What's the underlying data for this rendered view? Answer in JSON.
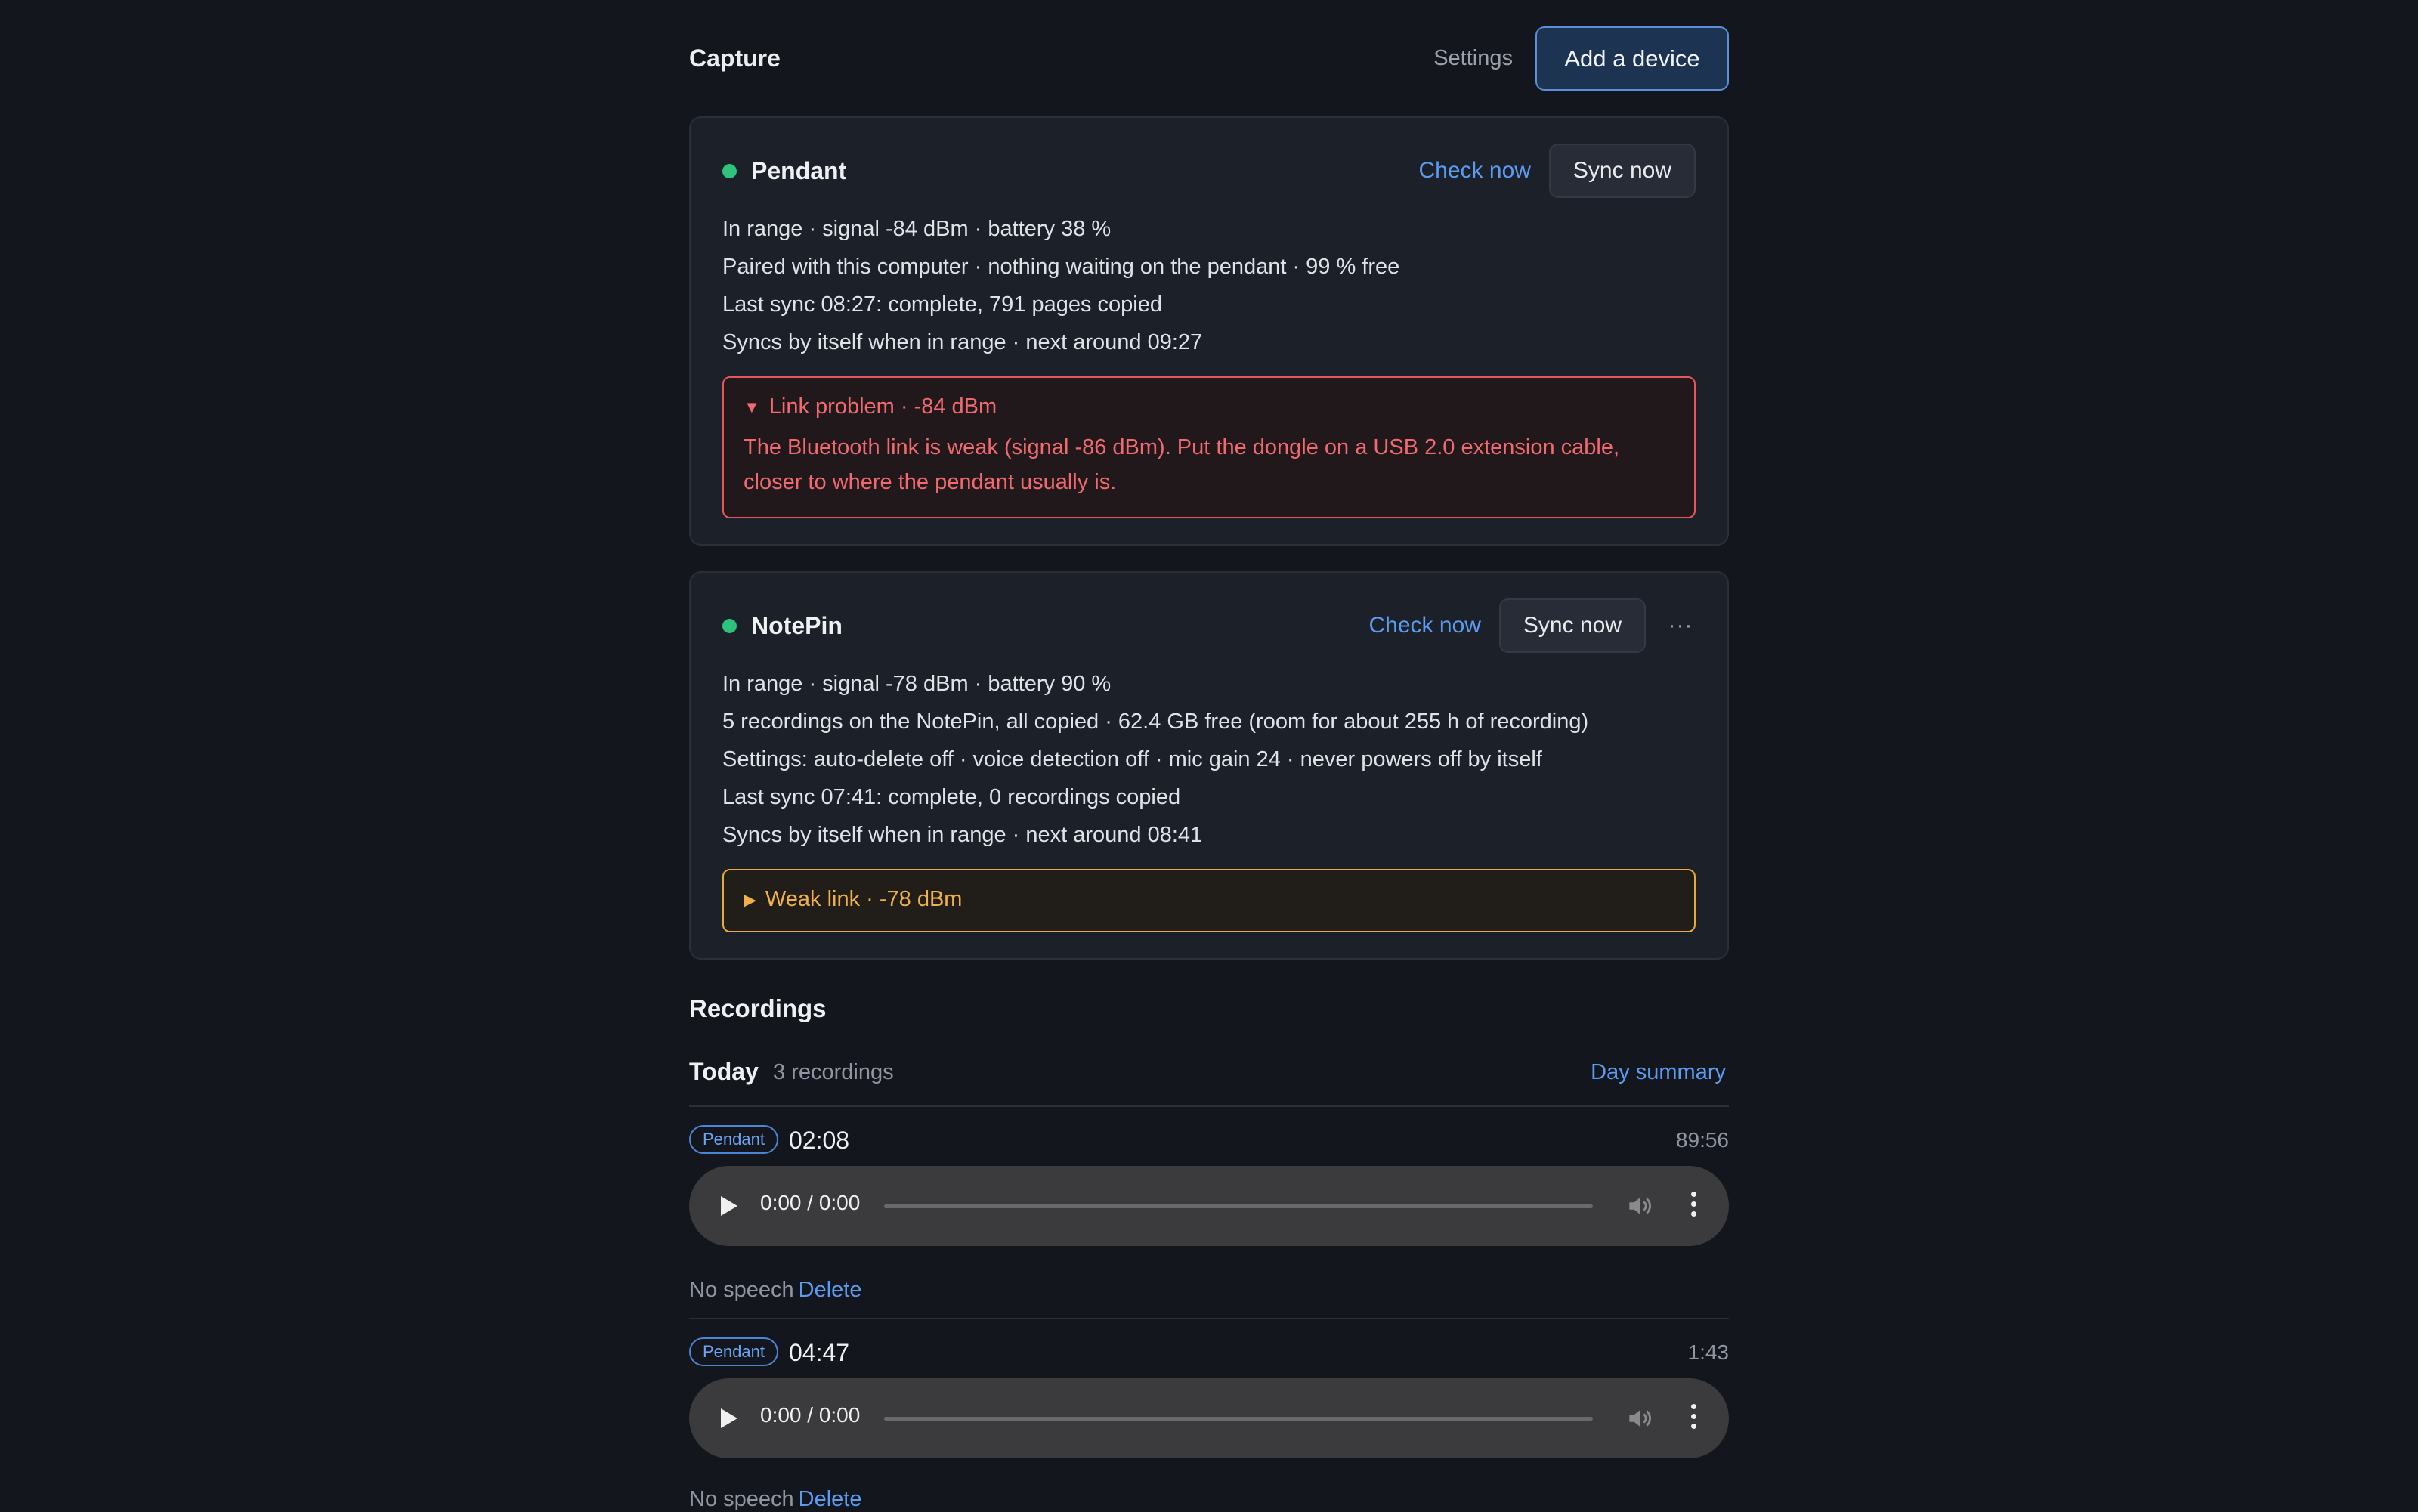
{
  "header": {
    "title": "Capture",
    "settings_label": "Settings",
    "add_device_label": "Add a device"
  },
  "devices": [
    {
      "name": "Pendant",
      "status_color": "#2fc27a",
      "check_label": "Check now",
      "sync_label": "Sync now",
      "lines": [
        "In range · signal -84 dBm · battery 38 %",
        "Paired with this computer · nothing waiting on the pendant · 99 % free",
        "Last sync 08:27: complete, 791 pages copied",
        "Syncs by itself when in range · next around 09:27"
      ],
      "alert": {
        "kind": "error",
        "expanded": true,
        "title": "Link problem · -84 dBm",
        "body": "The Bluetooth link is weak (signal -86 dBm). Put the dongle on a USB 2.0 extension cable, closer to where the pendant usually is."
      }
    },
    {
      "name": "NotePin",
      "status_color": "#2fc27a",
      "check_label": "Check now",
      "sync_label": "Sync now",
      "more_label": "···",
      "lines": [
        "In range · signal -78 dBm · battery 90 %",
        "5 recordings on the NotePin, all copied · 62.4 GB free (room for about 255 h of recording)",
        "Settings: auto-delete off · voice detection off · mic gain 24 · never powers off by itself",
        "Last sync 07:41: complete, 0 recordings copied",
        "Syncs by itself when in range · next around 08:41"
      ],
      "alert": {
        "kind": "warning",
        "expanded": false,
        "title": "Weak link · -78 dBm"
      }
    }
  ],
  "recordings": {
    "title": "Recordings",
    "day": {
      "label": "Today",
      "count": "3 recordings",
      "summary_label": "Day summary"
    },
    "items": [
      {
        "tag": "Pendant",
        "time": "02:08",
        "duration": "89:56",
        "player_time": "0:00 / 0:00",
        "status": "No speech",
        "delete_label": "Delete"
      },
      {
        "tag": "Pendant",
        "time": "04:47",
        "duration": "1:43",
        "player_time": "0:00 / 0:00",
        "status": "No speech",
        "delete_label": "Delete"
      }
    ]
  },
  "colors": {
    "accent": "#5b9bf0",
    "error": "#f06a6f",
    "warning": "#f0b04b",
    "ok": "#2fc27a"
  }
}
